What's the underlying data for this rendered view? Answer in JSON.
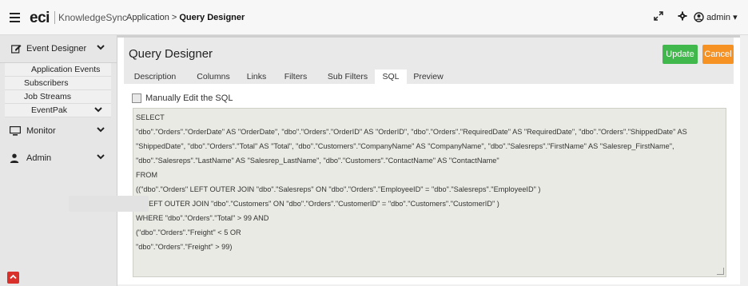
{
  "topbar": {
    "logo": "eci",
    "logo_sub": "KnowledgeSync",
    "breadcrumb_app": "Application >",
    "breadcrumb_page": "Query Designer",
    "expand_icon": "expand-icon",
    "settings_icon": "gear-icon",
    "user_label": "admin"
  },
  "sidebar": {
    "event_designer": "Event Designer",
    "items": [
      {
        "label": "Application Events"
      },
      {
        "label": "Subscribers"
      },
      {
        "label": "Job Streams"
      },
      {
        "label": "EventPak"
      }
    ],
    "monitor": "Monitor",
    "admin": "Admin"
  },
  "main": {
    "title": "Query Designer",
    "update_label": "Update",
    "cancel_label": "Cancel",
    "tabs": [
      {
        "label": "Description"
      },
      {
        "label": "Columns"
      },
      {
        "label": "Links"
      },
      {
        "label": "Filters"
      },
      {
        "label": "Sub Filters"
      },
      {
        "label": "SQL"
      },
      {
        "label": "Preview"
      }
    ],
    "active_tab": "SQL",
    "manual_edit_label": "Manually Edit the SQL",
    "sql_lines": [
      "SELECT",
      "\"dbo\".\"Orders\".\"OrderDate\" AS \"OrderDate\", \"dbo\".\"Orders\".\"OrderID\" AS \"OrderID\", \"dbo\".\"Orders\".\"RequiredDate\" AS \"RequiredDate\", \"dbo\".\"Orders\".\"ShippedDate\" AS",
      "\"ShippedDate\", \"dbo\".\"Orders\".\"Total\" AS \"Total\", \"dbo\".\"Customers\".\"CompanyName\" AS \"CompanyName\", \"dbo\".\"Salesreps\".\"FirstName\" AS \"Salesrep_FirstName\",",
      "\"dbo\".\"Salesreps\".\"LastName\" AS \"Salesrep_LastName\", \"dbo\".\"Customers\".\"ContactName\" AS \"ContactName\"",
      " FROM",
      "((\"dbo\".\"Orders\" LEFT OUTER JOIN \"dbo\".\"Salesreps\" ON \"dbo\".\"Orders\".\"EmployeeID\" = \"dbo\".\"Salesreps\".\"EmployeeID\" )",
      "LEFT OUTER JOIN \"dbo\".\"Customers\" ON \"dbo\".\"Orders\".\"CustomerID\" = \"dbo\".\"Customers\".\"CustomerID\" )",
      " WHERE \"dbo\".\"Orders\".\"Total\"  > 99 AND",
      "(\"dbo\".\"Orders\".\"Freight\"  < 5 OR",
      "\"dbo\".\"Orders\".\"Freight\"  > 99)"
    ]
  },
  "colors": {
    "update": "#40b84c",
    "cancel": "#f59223",
    "collapse": "#d9302b"
  }
}
